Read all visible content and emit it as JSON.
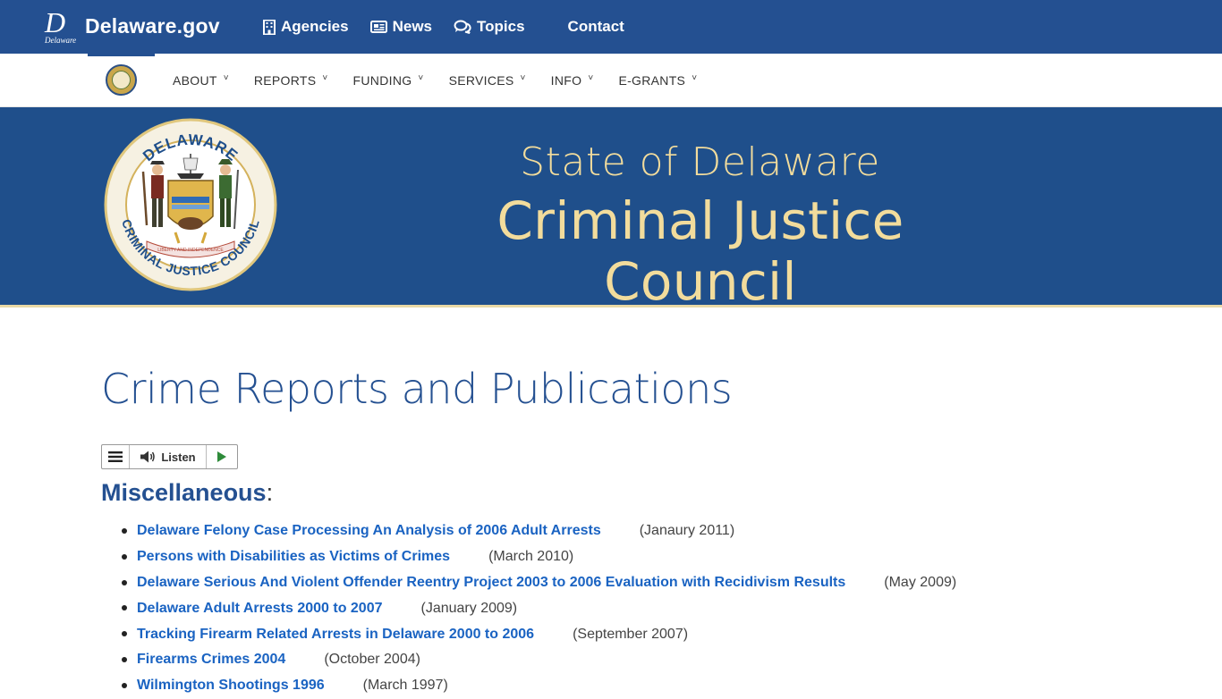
{
  "gov_bar": {
    "logo_text": "Delaware.gov",
    "logo_mark": "D",
    "logo_small": "Delaware",
    "nav": [
      {
        "label": "Agencies",
        "icon": "building-icon"
      },
      {
        "label": "News",
        "icon": "newspaper-icon"
      },
      {
        "label": "Topics",
        "icon": "chat-bubbles-icon"
      }
    ],
    "contact_label": "Contact"
  },
  "agency_nav": {
    "items": [
      {
        "label": "ABOUT"
      },
      {
        "label": "REPORTS"
      },
      {
        "label": "FUNDING"
      },
      {
        "label": "SERVICES"
      },
      {
        "label": "INFO"
      },
      {
        "label": "E-GRANTS"
      }
    ],
    "caret": "˅"
  },
  "banner": {
    "subtitle": "State of Delaware",
    "title": "Criminal Justice Council",
    "seal_top_text": "DELAWARE",
    "seal_bottom_text": "CRIMINAL JUSTICE COUNCIL",
    "seal_ribbon_text": "LIBERTY AND INDEPENDENCE"
  },
  "main": {
    "page_title": "Crime Reports and Publications",
    "listen_label": "Listen",
    "section_heading": "Miscellaneous",
    "section_colon": ":",
    "reports": [
      {
        "title": "Delaware Felony Case Processing An Analysis of 2006 Adult Arrests",
        "date": "(Janaury 2011)"
      },
      {
        "title": "Persons with Disabilities as Victims of Crimes",
        "date": "(March 2010)"
      },
      {
        "title": "Delaware Serious And Violent Offender Reentry Project 2003 to 2006 Evaluation with Recidivism Results",
        "date": "(May 2009)"
      },
      {
        "title": "Delaware Adult Arrests 2000 to 2007",
        "date": "(January 2009)"
      },
      {
        "title": "Tracking Firearm Related Arrests in Delaware 2000 to 2006",
        "date": "(September 2007)"
      },
      {
        "title": "Firearms Crimes 2004",
        "date": "(October 2004)"
      },
      {
        "title": "Wilmington Shootings 1996",
        "date": "(March 1997)"
      }
    ]
  },
  "colors": {
    "gov_blue": "#245091",
    "banner_blue": "#1f4f8b",
    "banner_gold": "#f2dc9c",
    "link_blue": "#1a63c2"
  }
}
